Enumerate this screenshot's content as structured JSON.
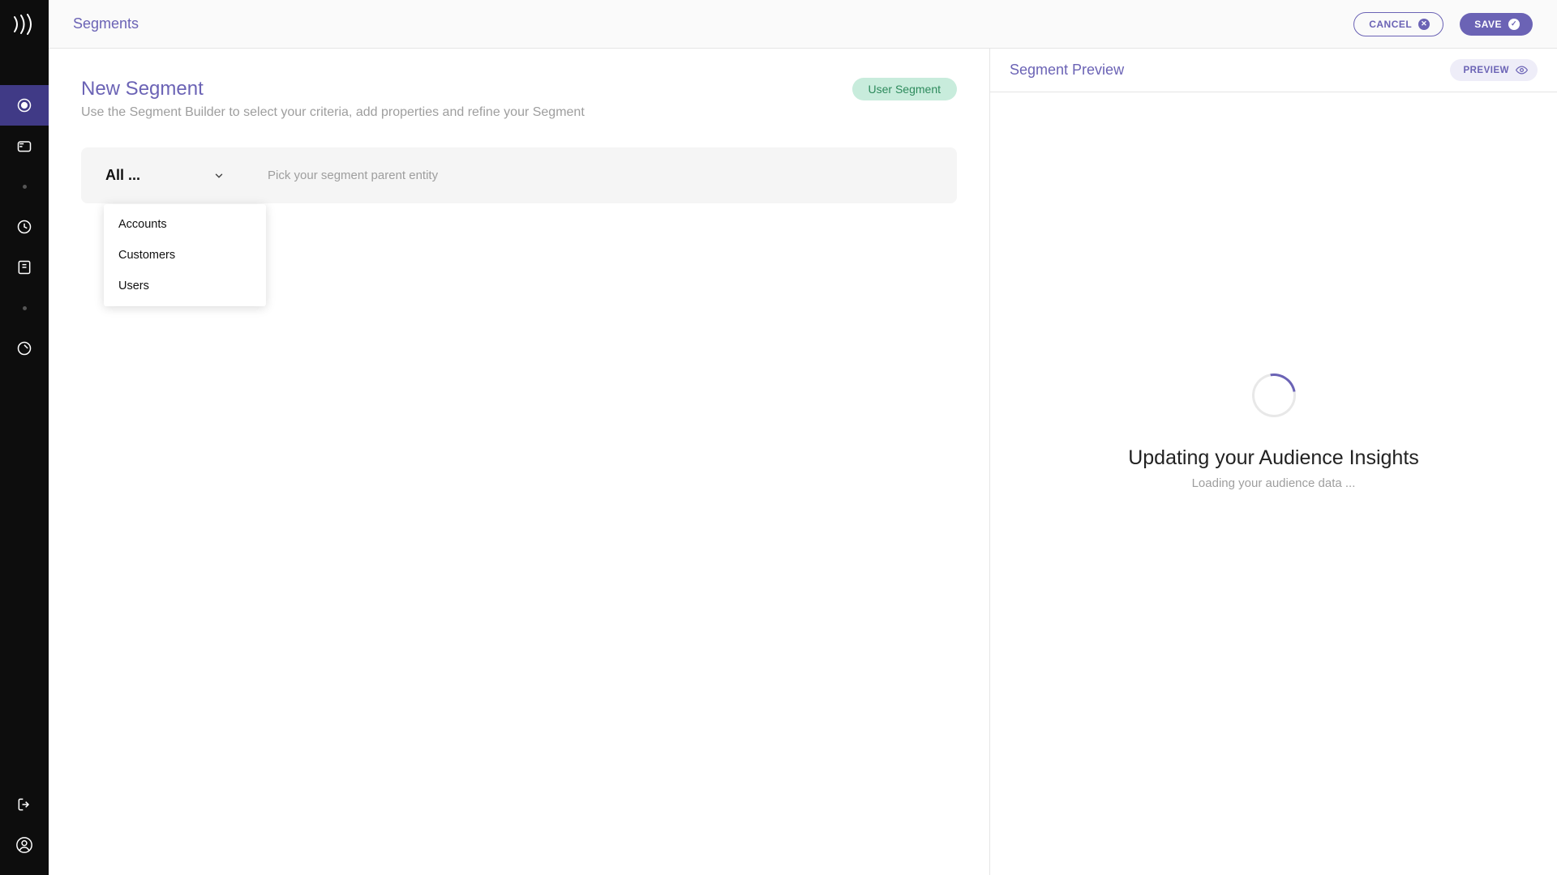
{
  "breadcrumb": "Segments",
  "actions": {
    "cancel": "CANCEL",
    "save": "SAVE",
    "preview": "PREVIEW"
  },
  "builder": {
    "title": "New Segment",
    "subtitle": "Use the Segment Builder to select your criteria, add properties and refine your Segment",
    "badge": "User Segment",
    "entity_selector": {
      "label": "All ...",
      "hint": "Pick your segment parent entity"
    },
    "dropdown": {
      "options": [
        "Accounts",
        "Customers",
        "Users"
      ]
    }
  },
  "preview": {
    "title": "Segment Preview",
    "heading": "Updating your Audience Insights",
    "sub": "Loading your audience data ..."
  }
}
